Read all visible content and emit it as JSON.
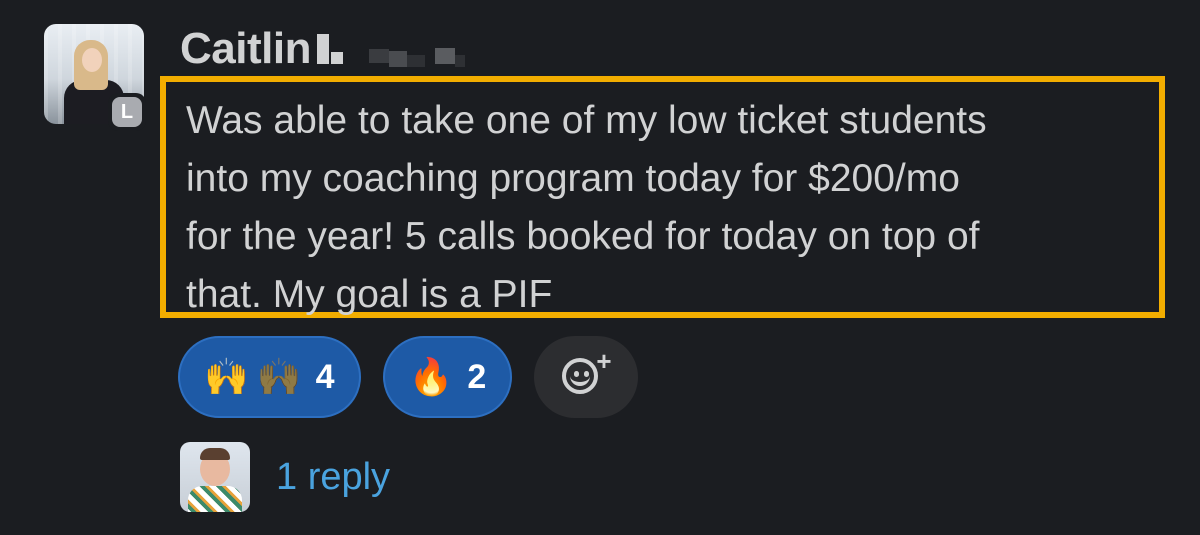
{
  "message": {
    "author": {
      "name": "Caitlin",
      "badge": "L",
      "avatar_icon": "user-avatar-photo"
    },
    "text": "Was able to take one of my low ticket students\ninto my coaching program today for $200/mo\nfor the year! 5 calls booked for today on top of\nthat. My goal is a PIF",
    "highlight_color": "#f2ad00"
  },
  "reactions": [
    {
      "emoji": "🙌",
      "emoji_alt": "🙌",
      "icon": "raising-hands-icon",
      "count": "4"
    },
    {
      "emoji": "🔥",
      "icon": "fire-icon",
      "count": "2"
    }
  ],
  "add_reaction": {
    "icon": "add-reaction-icon"
  },
  "thread": {
    "reply_label": "1 reply",
    "avatar_icon": "reply-user-avatar"
  },
  "colors": {
    "background": "#1b1d21",
    "text": "#d1d2d3",
    "reaction_bg": "#1e5aa6",
    "link": "#4aa3df"
  }
}
